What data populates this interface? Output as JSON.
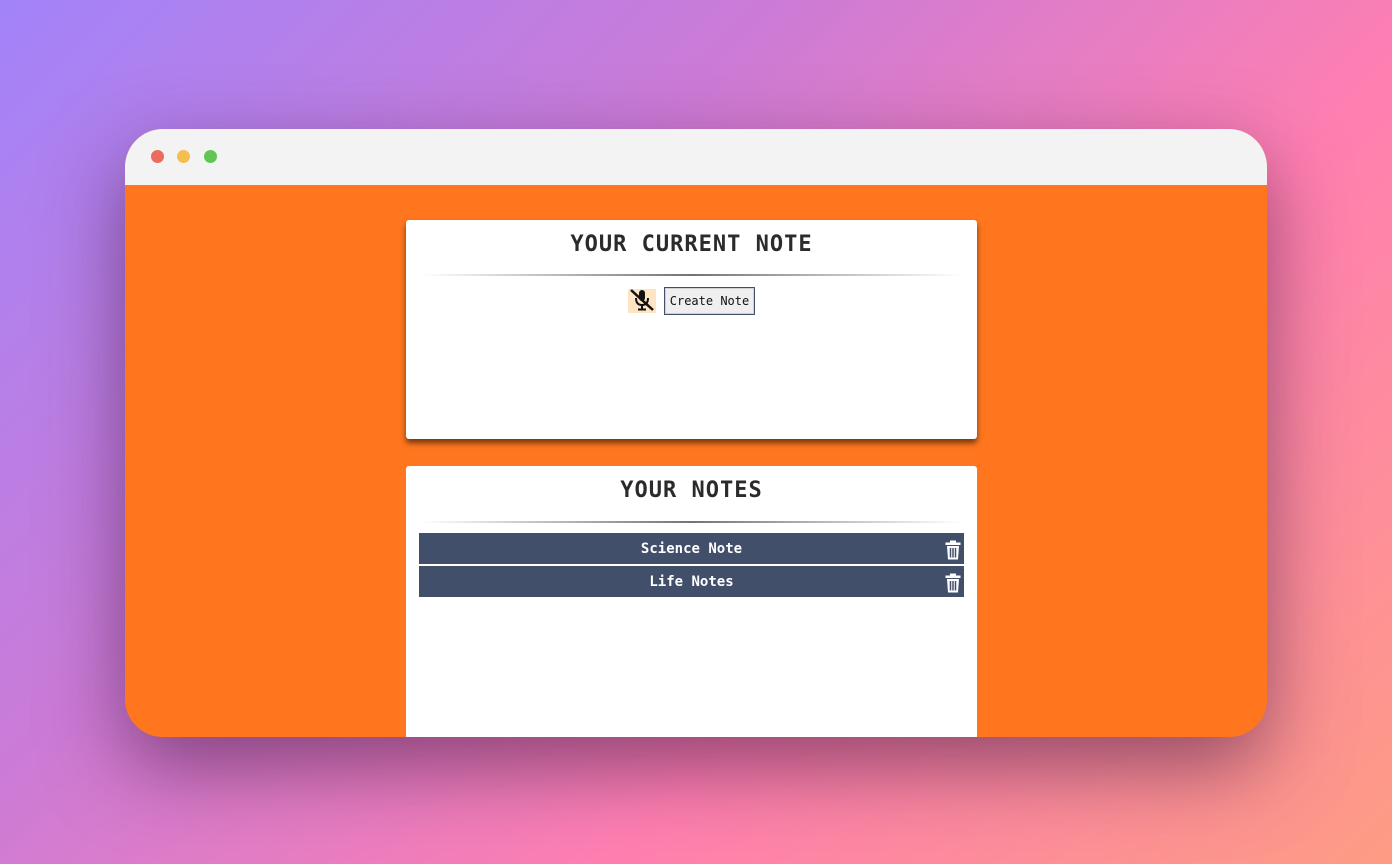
{
  "window": {
    "controls": [
      "close",
      "minimize",
      "maximize"
    ]
  },
  "current_note": {
    "title": "YOUR CURRENT NOTE",
    "mic_icon": "mic-off-icon",
    "create_label": "Create Note",
    "body": ""
  },
  "notes": {
    "title": "YOUR NOTES",
    "items": [
      {
        "label": "Science Note",
        "delete_icon": "trash-icon"
      },
      {
        "label": "Life Notes",
        "delete_icon": "trash-icon"
      }
    ]
  },
  "colors": {
    "background": "#ff761e",
    "card": "#ffffff",
    "note_item": "#424f6b",
    "mic_bg": "#ffe4c4"
  }
}
